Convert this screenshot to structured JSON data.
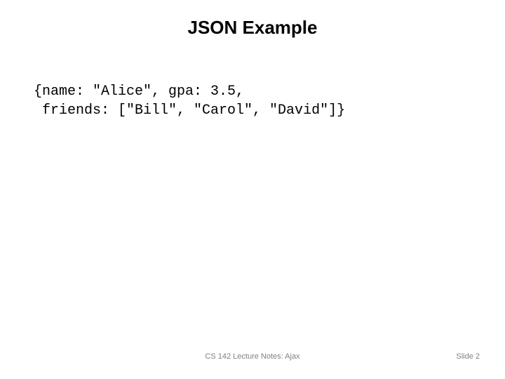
{
  "title": "JSON Example",
  "code": {
    "line1": "{name: \"Alice\", gpa: 3.5,",
    "line2": " friends: [\"Bill\", \"Carol\", \"David\"]}"
  },
  "footer": {
    "center": "CS 142 Lecture Notes: Ajax",
    "right": "Slide 2"
  }
}
